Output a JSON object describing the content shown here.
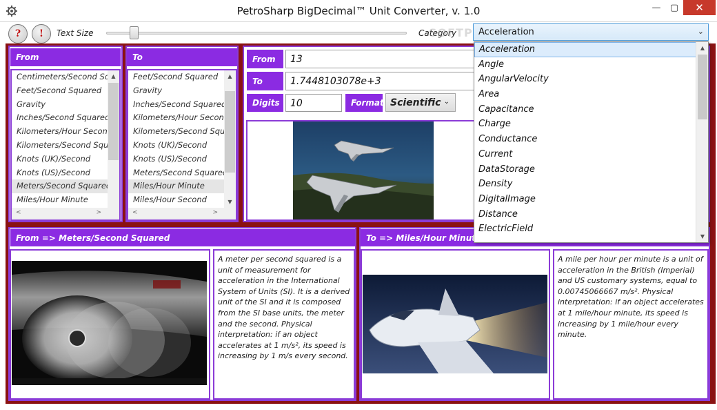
{
  "window": {
    "title": "PetroSharp BigDecimal™ Unit Converter, v. 1.0",
    "minimize_glyph": "—",
    "maximize_glyph": "▢",
    "close_glyph": "✕"
  },
  "toolbar": {
    "help_label": "?",
    "info_label": "!",
    "text_size_label": "Text Size",
    "text_size_level": 0.08,
    "category_label": "Category",
    "category_value": "Acceleration",
    "watermark": "SOFTPEDIA"
  },
  "from_panel": {
    "header": "From",
    "items": [
      "Centimeters/Second Squared",
      "Feet/Second Squared",
      "Gravity",
      "Inches/Second Squared",
      "Kilometers/Hour Second",
      "Kilometers/Second Squared",
      "Knots (UK)/Second",
      "Knots (US)/Second",
      "Meters/Second Squared",
      "Miles/Hour Minute"
    ],
    "selected_index": 8
  },
  "to_panel": {
    "header": "To",
    "items": [
      "Feet/Second Squared",
      "Gravity",
      "Inches/Second Squared",
      "Kilometers/Hour Second",
      "Kilometers/Second Squared",
      "Knots (UK)/Second",
      "Knots (US)/Second",
      "Meters/Second Squared",
      "Miles/Hour Minute",
      "Miles/Hour Second"
    ],
    "selected_index": 8
  },
  "converter": {
    "from_label": "From",
    "from_value": "13",
    "to_label": "To",
    "to_value": "1.7448103078e+3",
    "digits_label": "Digits",
    "digits_value": "10",
    "format_label": "Format",
    "format_value": "Scientific"
  },
  "from_detail": {
    "header": "From =>   Meters/Second Squared",
    "description": "A meter per second squared is a unit of measurement for acceleration in the International System of Units (SI). It is a derived unit of the SI and it is composed from the SI base units, the meter and the second. Physical interpretation: if an object accelerates at 1 m/s², its speed is increasing by 1 m/s every second."
  },
  "to_detail": {
    "header": "To =>   Miles/Hour Minute",
    "description": "A mile per hour per minute is a unit of acceleration in the British (Imperial) and US customary systems, equal to 0.00745066667 m/s². Physical interpretation: if an object accelerates at 1 mile/hour minute, its speed is increasing by 1 mile/hour every minute."
  },
  "category_dropdown": {
    "items": [
      "Acceleration",
      "Angle",
      "AngularVelocity",
      "Area",
      "Capacitance",
      "Charge",
      "Conductance",
      "Current",
      "DataStorage",
      "Density",
      "DigitalImage",
      "Distance",
      "ElectricField"
    ],
    "selected_index": 0
  },
  "colors": {
    "accent_purple": "#8b2be2",
    "frame_red": "#8a1212",
    "close_red": "#c7392b",
    "dropdown_highlight": "#dcecfc"
  }
}
